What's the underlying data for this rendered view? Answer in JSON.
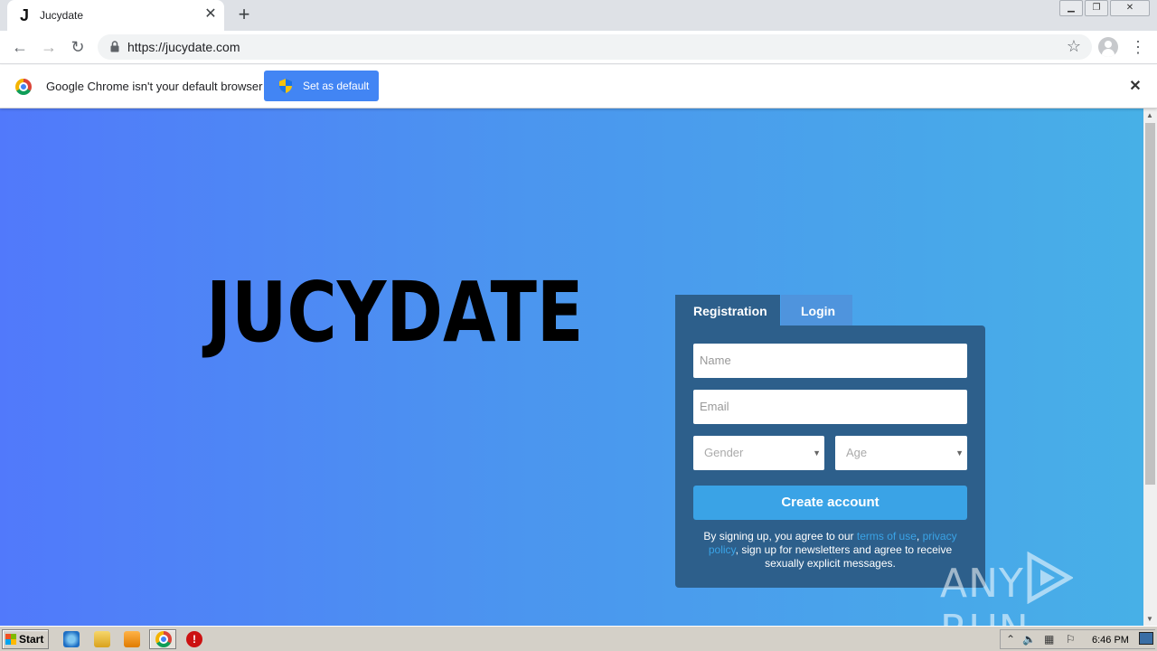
{
  "browser": {
    "tab_title": "Jucydate",
    "tab_favicon": "J",
    "url": "https://jucydate.com",
    "icons": [
      "back-icon",
      "forward-icon",
      "reload-icon",
      "lock-icon",
      "star-icon",
      "profile-icon",
      "menu-icon"
    ]
  },
  "infobar": {
    "message": "Google Chrome isn't your default browser",
    "button_label": "Set as default"
  },
  "page": {
    "brand": "JUCYDATE",
    "tabs": [
      "Registration",
      "Login"
    ],
    "active_tab": "Registration",
    "form": {
      "name_placeholder": "Name",
      "email_placeholder": "Email",
      "gender_placeholder": "Gender",
      "age_placeholder": "Age",
      "submit_label": "Create account"
    },
    "legal": {
      "prefix": "By signing up, you agree to our ",
      "terms_link": "terms of use",
      "separator": ", ",
      "privacy_link": "privacy policy",
      "suffix": ", sign up for newsletters and agree to receive sexually explicit messages."
    },
    "colors": {
      "gradient_start": "#5179fb",
      "gradient_end": "#47b0e7",
      "panel": "#2d5f8b",
      "button": "#3aa3e6"
    }
  },
  "watermark": {
    "left": "ANY",
    "right": "RUN"
  },
  "taskbar": {
    "start_label": "Start",
    "clock": "6:46 PM"
  }
}
